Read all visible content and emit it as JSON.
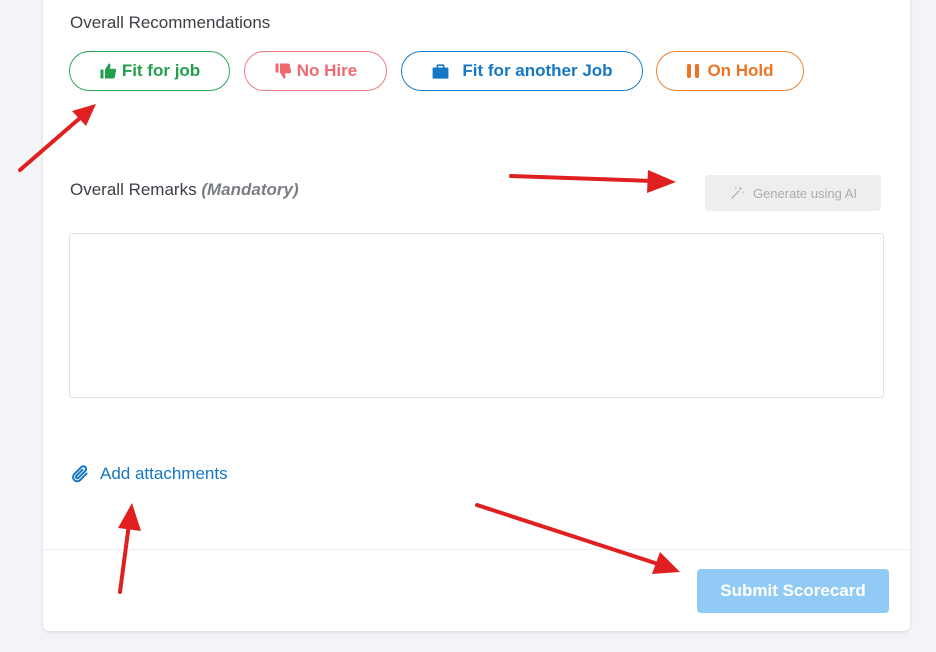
{
  "recommendations": {
    "title": "Overall Recommendations",
    "options": [
      {
        "label": "Fit for job",
        "icon": "thumbs-up-icon",
        "color": "#22a04c"
      },
      {
        "label": "No Hire",
        "icon": "thumbs-down-icon",
        "color": "#ef6a70"
      },
      {
        "label": "Fit for another Job",
        "icon": "briefcase-icon",
        "color": "#1677c4"
      },
      {
        "label": "On Hold",
        "icon": "pause-icon",
        "color": "#ec7425"
      }
    ]
  },
  "remarks": {
    "title": "Overall Remarks",
    "mandatory_label": "(Mandatory)",
    "generate_label": "Generate using AI",
    "value": ""
  },
  "attachments": {
    "label": "Add attachments",
    "icon": "paperclip-icon"
  },
  "footer": {
    "submit_label": "Submit Scorecard",
    "submit_color": "#90caf5"
  },
  "annotations": {
    "arrow_color": "#e02020"
  }
}
